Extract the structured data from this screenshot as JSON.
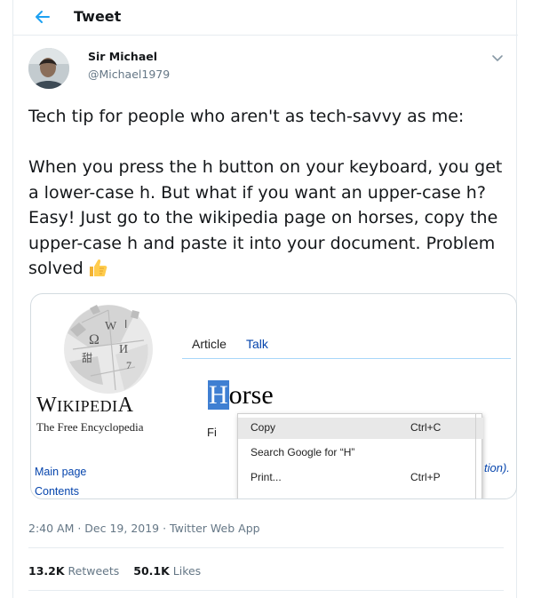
{
  "header": {
    "title": "Tweet"
  },
  "author": {
    "name": "Sir Michael",
    "handle": "@Michael1979"
  },
  "tweet": {
    "line1": "Tech tip for people who aren't as tech-savvy as me:",
    "para2": "When you press the h button on your keyboard, you get a lower-case h. But what if you want an upper-case h? Easy! Just go to the wikipedia page on horses, copy the upper-case h and paste it into your document. Problem solved"
  },
  "media": {
    "wordmark": "Wikipedia",
    "tagline": "The Free Encyclopedia",
    "sidebar_links": [
      "Main page",
      "Contents"
    ],
    "tabs": [
      "Article",
      "Talk"
    ],
    "heading_selected": "H",
    "heading_rest": "orse",
    "fragment_left": "Fi",
    "fragment_right": "tion).",
    "context_menu": [
      {
        "label": "Copy",
        "shortcut": "Ctrl+C"
      },
      {
        "label": "Search Google for “H”",
        "shortcut": ""
      },
      {
        "label": "Print...",
        "shortcut": "Ctrl+P"
      }
    ]
  },
  "meta": {
    "timestamp": "2:40 AM · Dec 19, 2019 · Twitter Web App",
    "retweets_count": "13.2K",
    "retweets_label": "Retweets",
    "likes_count": "50.1K",
    "likes_label": "Likes"
  },
  "colors": {
    "accent": "#1da1f2",
    "secondary_text": "#657786",
    "selection": "#3f7fd2",
    "link": "#0645ad"
  },
  "icons": [
    "back-arrow-icon",
    "chevron-down-icon",
    "thumbs-up-emoji-icon",
    "wikipedia-globe-icon"
  ]
}
